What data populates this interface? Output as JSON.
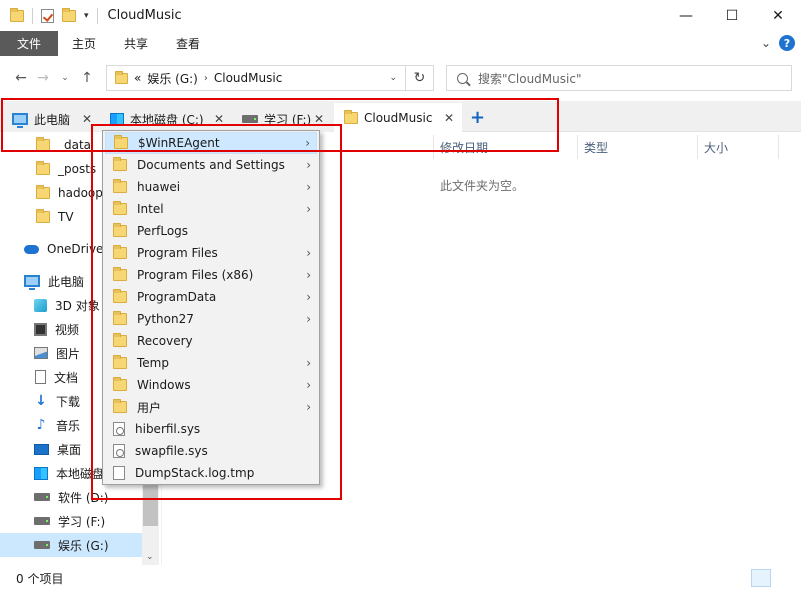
{
  "window": {
    "title": "CloudMusic",
    "minimize": "—",
    "maximize": "☐",
    "close": "✕"
  },
  "ribbon": {
    "tabs": [
      "文件",
      "主页",
      "共享",
      "查看"
    ],
    "collapse": "⌄",
    "help": "?"
  },
  "address": {
    "overflow": "«",
    "segments": [
      "娱乐 (G:)",
      "CloudMusic"
    ],
    "search_placeholder": "搜索\"CloudMusic\""
  },
  "tabs": [
    {
      "label": "此电脑",
      "icon": "pc-icon"
    },
    {
      "label": "本地磁盘 (C:)",
      "icon": "windows-drive-icon"
    },
    {
      "label": "学习 (F:)",
      "icon": "drive-icon"
    },
    {
      "label": "CloudMusic",
      "icon": "folder-icon",
      "active": true
    }
  ],
  "sidebar": {
    "items": [
      {
        "label": "_data",
        "icon": "folder-icon"
      },
      {
        "label": "_posts",
        "icon": "folder-icon"
      },
      {
        "label": "hadoop",
        "icon": "folder-icon"
      },
      {
        "label": "TV",
        "icon": "folder-icon"
      },
      {
        "label": "OneDrive",
        "icon": "onedrive-icon"
      },
      {
        "label": "此电脑",
        "icon": "pc-icon"
      },
      {
        "label": "3D 对象",
        "icon": "3d-objects-icon"
      },
      {
        "label": "视频",
        "icon": "video-icon"
      },
      {
        "label": "图片",
        "icon": "pictures-icon"
      },
      {
        "label": "文档",
        "icon": "documents-icon"
      },
      {
        "label": "下载",
        "icon": "downloads-icon"
      },
      {
        "label": "音乐",
        "icon": "music-icon"
      },
      {
        "label": "桌面",
        "icon": "desktop-icon"
      },
      {
        "label": "本地磁盘 (C:)",
        "icon": "windows-drive-icon"
      },
      {
        "label": "软件 (D:)",
        "icon": "drive-icon"
      },
      {
        "label": "学习 (F:)",
        "icon": "drive-icon"
      },
      {
        "label": "娱乐 (G:)",
        "icon": "drive-icon",
        "selected": true
      }
    ]
  },
  "columns": {
    "modified": "修改日期",
    "type": "类型",
    "size": "大小"
  },
  "empty_message": "此文件夹为空。",
  "menu": {
    "items": [
      {
        "label": "$WinREAgent",
        "icon": "folder-icon",
        "submenu": true,
        "highlighted": true
      },
      {
        "label": "Documents and Settings",
        "icon": "folder-icon",
        "submenu": true
      },
      {
        "label": "huawei",
        "icon": "folder-icon",
        "submenu": true
      },
      {
        "label": "Intel",
        "icon": "folder-icon",
        "submenu": true
      },
      {
        "label": "PerfLogs",
        "icon": "folder-icon",
        "submenu": false
      },
      {
        "label": "Program Files",
        "icon": "folder-icon",
        "submenu": true
      },
      {
        "label": "Program Files (x86)",
        "icon": "folder-icon",
        "submenu": true
      },
      {
        "label": "ProgramData",
        "icon": "folder-icon",
        "submenu": true
      },
      {
        "label": "Python27",
        "icon": "folder-icon",
        "submenu": true
      },
      {
        "label": "Recovery",
        "icon": "folder-icon",
        "submenu": false
      },
      {
        "label": "Temp",
        "icon": "folder-icon",
        "submenu": true
      },
      {
        "label": "Windows",
        "icon": "folder-icon",
        "submenu": true
      },
      {
        "label": "用户",
        "icon": "folder-icon",
        "submenu": true
      },
      {
        "label": "hiberfil.sys",
        "icon": "system-file-icon",
        "submenu": false
      },
      {
        "label": "swapfile.sys",
        "icon": "system-file-icon",
        "submenu": false
      },
      {
        "label": "DumpStack.log.tmp",
        "icon": "file-icon",
        "submenu": false
      }
    ]
  },
  "status": {
    "item_count": "0 个项目"
  },
  "colors": {
    "accent": "#1e73d0",
    "selection": "#cce8ff",
    "annotation_red": "#e00000",
    "file_tab": "#5a5a5a"
  }
}
